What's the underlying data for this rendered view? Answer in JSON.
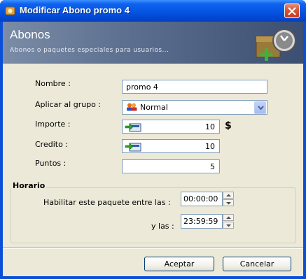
{
  "window": {
    "title": "Modificar Abono promo 4",
    "close_icon": "close-icon"
  },
  "header": {
    "title": "Abonos",
    "subtitle": "Abonos o paquetes especiales para usuarios...",
    "graphic_icon": "clock-box-add-icon"
  },
  "form": {
    "nombre": {
      "label": "Nombre :",
      "value": "promo 4"
    },
    "grupo": {
      "label": "Aplicar al grupo :",
      "value": "Normal",
      "icon": "user-group-icon"
    },
    "importe": {
      "label": "Importe :",
      "value": "10",
      "currency": "$",
      "icon": "money-icon"
    },
    "credito": {
      "label": "Credito :",
      "value": "10",
      "icon": "money-icon"
    },
    "puntos": {
      "label": "Puntos :",
      "value": "5"
    }
  },
  "horario": {
    "legend": "Horario",
    "start": {
      "label": "Habilitar este paquete entre las :",
      "value": "00:00:00"
    },
    "end": {
      "label": "y las :",
      "value": "23:59:59"
    }
  },
  "buttons": {
    "accept": "Aceptar",
    "cancel": "Cancelar"
  },
  "colors": {
    "titlebar": "#0554e2",
    "header": "#5d7090",
    "dialog_bg": "#ece9d8"
  }
}
